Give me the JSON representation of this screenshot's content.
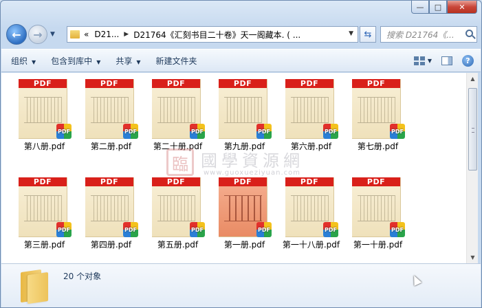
{
  "window": {
    "controls": {
      "minimize": "—",
      "maximize": "□",
      "close": "✕"
    }
  },
  "nav": {
    "back_icon": "back-arrow-icon",
    "forward_icon": "forward-arrow-icon",
    "address": {
      "overflow": "«",
      "crumbs": [
        "D21...",
        "D21764《汇刻书目二十卷》天一阁藏本. ( ..."
      ]
    },
    "search_placeholder": "搜索 D21764《..."
  },
  "toolbar": {
    "organize": "组织",
    "include_in_library": "包含到库中",
    "share": "共享",
    "new_folder": "新建文件夹"
  },
  "files": [
    {
      "name": "第八册.pdf",
      "thumb": "PDF"
    },
    {
      "name": "第二册.pdf",
      "thumb": "PDF"
    },
    {
      "name": "第二十册.pdf",
      "thumb": "PDF"
    },
    {
      "name": "第九册.pdf",
      "thumb": "PDF"
    },
    {
      "name": "第六册.pdf",
      "thumb": "PDF"
    },
    {
      "name": "第七册.pdf",
      "thumb": "PDF"
    },
    {
      "name": "第三册.pdf",
      "thumb": "PDF"
    },
    {
      "name": "第四册.pdf",
      "thumb": "PDF"
    },
    {
      "name": "第五册.pdf",
      "thumb": "PDF"
    },
    {
      "name": "第一册.pdf",
      "thumb": "PDF",
      "cover": "red"
    },
    {
      "name": "第一十八册.pdf",
      "thumb": "PDF"
    },
    {
      "name": "第一十册.pdf",
      "thumb": "PDF"
    }
  ],
  "watermark": {
    "seal": "臨",
    "title": "國學資源網",
    "url": "www.guoxueziyuan.com"
  },
  "details": {
    "count": "20 个对象"
  }
}
